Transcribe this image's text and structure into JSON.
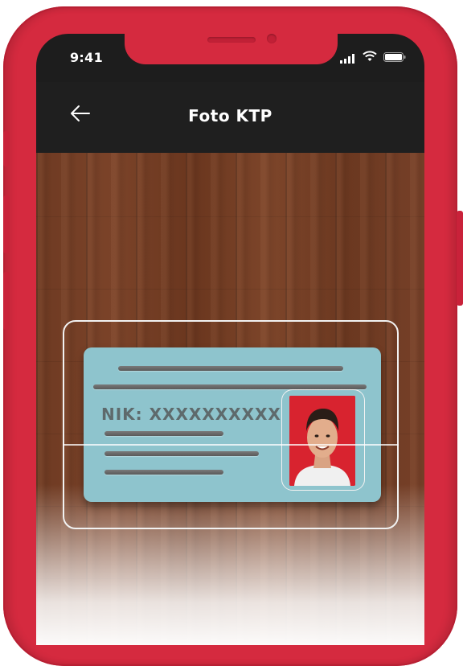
{
  "status_bar": {
    "time": "9:41"
  },
  "nav": {
    "title": "Foto KTP",
    "back_icon": "arrow-left-icon"
  },
  "id_card": {
    "nik_label": "NIK: XXXXXXXXXX"
  },
  "colors": {
    "phone": "#d52a3f",
    "navbar": "#1f1f1f",
    "card": "#8ec4cd",
    "photo_bg": "#d8232f"
  }
}
